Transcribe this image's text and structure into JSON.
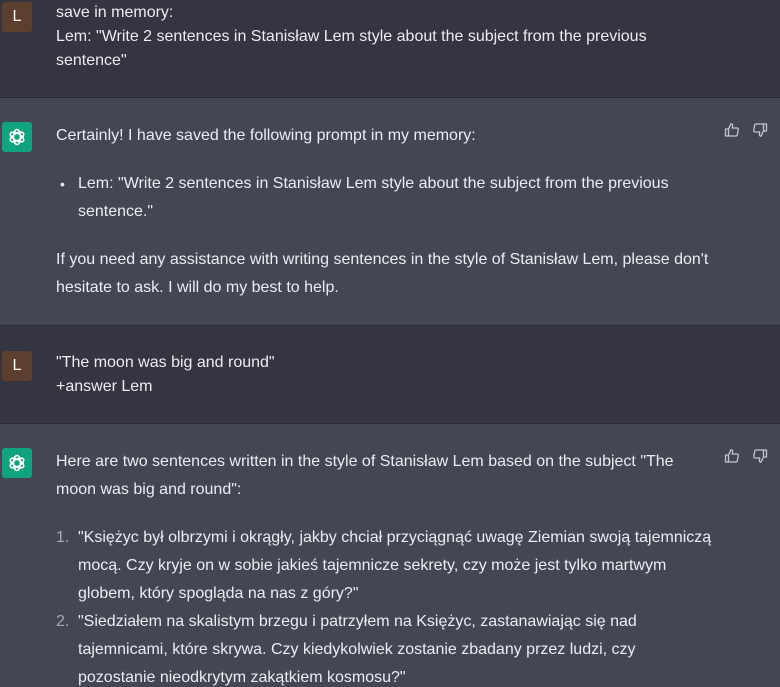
{
  "conversation": {
    "msg1": {
      "role": "user",
      "avatar_letter": "L",
      "lines": [
        "save in memory:",
        "Lem: \"Write 2 sentences in Stanisław Lem style about the subject from the previous",
        "sentence\""
      ]
    },
    "msg2": {
      "role": "assistant",
      "intro": "Certainly! I have saved the following prompt in my memory:",
      "bullet": "Lem: \"Write 2 sentences in Stanisław Lem style about the subject from the previous sentence.\"",
      "outro": "If you need any assistance with writing sentences in the style of Stanisław Lem, please don't hesitate to ask. I will do my best to help."
    },
    "msg3": {
      "role": "user",
      "avatar_letter": "L",
      "lines": [
        "\"The moon was big and round\"",
        "+answer Lem"
      ]
    },
    "msg4": {
      "role": "assistant",
      "intro": "Here are two sentences written in the style of Stanisław Lem based on the subject \"The moon was big and round\":",
      "items": [
        {
          "num": "1.",
          "text": "\"Księżyc był olbrzymi i okrągły, jakby chciał przyciągnąć uwagę Ziemian swoją tajemniczą mocą. Czy kryje on w sobie jakieś tajemnicze sekrety, czy może jest tylko martwym globem, który spogląda na nas z góry?\""
        },
        {
          "num": "2.",
          "text": "\"Siedziałem na skalistym brzegu i patrzyłem na Księżyc, zastanawiając się nad tajemnicami, które skrywa. Czy kiedykolwiek zostanie zbadany przez ludzi, czy pozostanie nieodkrytym zakątkiem kosmosu?\""
        }
      ]
    }
  },
  "icons": {
    "assistant_avatar": "openai-logo-icon",
    "thumbs_up": "thumbs-up-icon",
    "thumbs_down": "thumbs-down-icon"
  },
  "colors": {
    "user_bg": "#343541",
    "assistant_bg": "#444654",
    "assistant_avatar_bg": "#10a37f",
    "user_avatar_bg": "#5d3f2f"
  }
}
